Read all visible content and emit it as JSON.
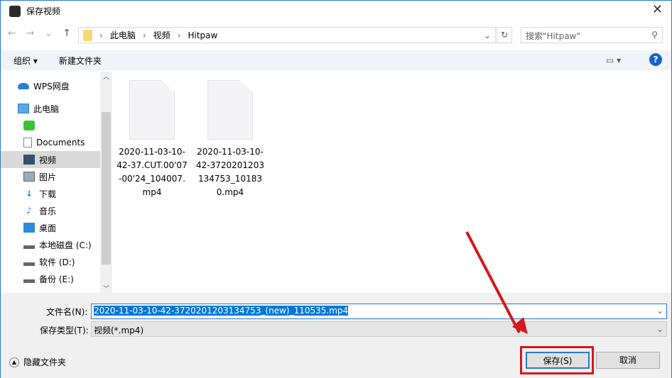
{
  "window": {
    "title": "保存视频",
    "close": "✕"
  },
  "nav": {
    "back": "←",
    "forward": "→",
    "recent": "⌄",
    "up": "↑"
  },
  "breadcrumb": [
    "此电脑",
    "视频",
    "Hitpaw"
  ],
  "search": {
    "placeholder": "搜索\"Hitpaw\""
  },
  "toolbar": {
    "organize": "组织 ▾",
    "new_folder": "新建文件夹",
    "help": "?"
  },
  "sidebar": [
    {
      "label": "WPS网盘",
      "icon": "cloud"
    },
    {
      "label": "此电脑",
      "icon": "computer"
    },
    {
      "label": "",
      "icon": "app-green"
    },
    {
      "label": "Documents",
      "icon": "document"
    },
    {
      "label": "视频",
      "icon": "video",
      "selected": true
    },
    {
      "label": "图片",
      "icon": "picture"
    },
    {
      "label": "下载",
      "icon": "download"
    },
    {
      "label": "音乐",
      "icon": "music"
    },
    {
      "label": "桌面",
      "icon": "desktop"
    },
    {
      "label": "本地磁盘 (C:)",
      "icon": "drive"
    },
    {
      "label": "软件 (D:)",
      "icon": "drive"
    },
    {
      "label": "备份 (E:)",
      "icon": "drive"
    }
  ],
  "files": [
    {
      "name": "2020-11-03-10-42-37.CUT.00'07-00'24_104007.mp4"
    },
    {
      "name": "2020-11-03-10-42-3720201203134753_101830.mp4"
    }
  ],
  "form": {
    "filename_label": "文件名(N):",
    "filename": "2020-11-03-10-42-3720201203134753_(new)_110535.mp4",
    "type_label": "保存类型(T):",
    "type": "视频(*.mp4)"
  },
  "footer": {
    "hide_folders": "隐藏文件夹",
    "save": "保存(S)",
    "cancel": "取消"
  }
}
